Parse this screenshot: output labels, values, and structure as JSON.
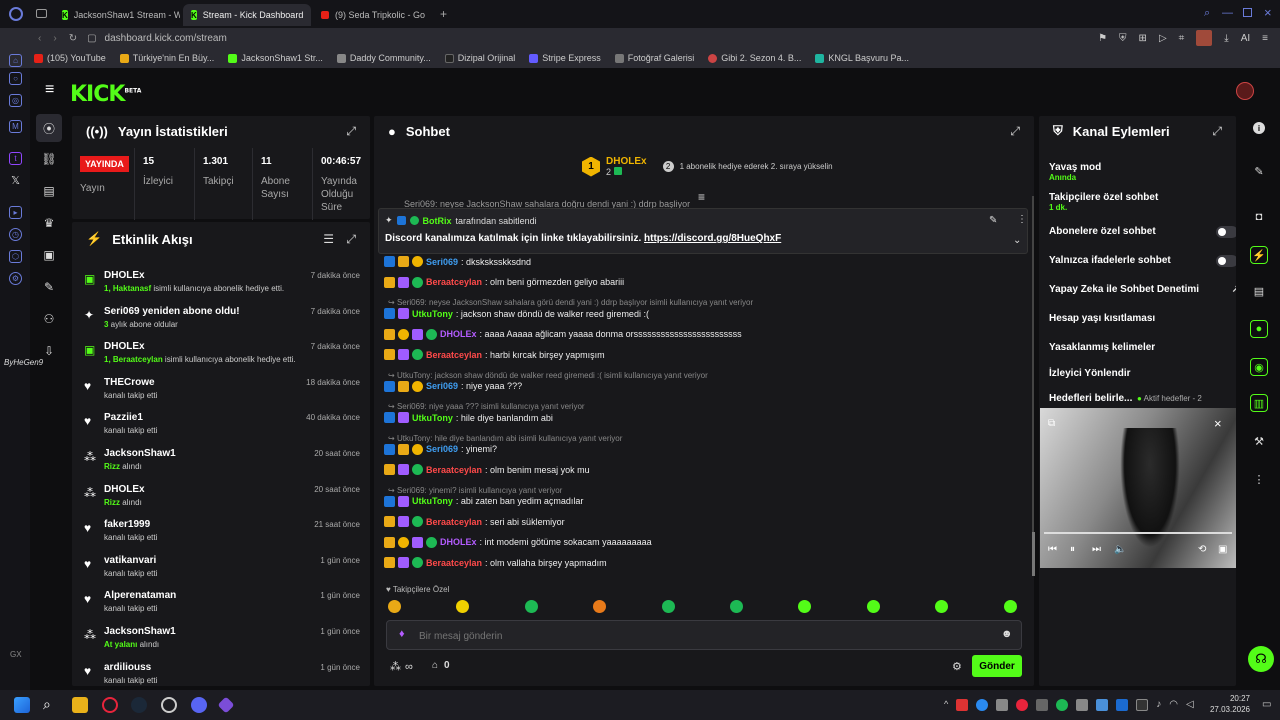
{
  "browser": {
    "tabs": [
      {
        "label": "JacksonShaw1 Stream - W"
      },
      {
        "label": "Stream - Kick Dashboard"
      },
      {
        "label": "(9) Seda Tripkolic - Go"
      }
    ],
    "url": "dashboard.kick.com/stream",
    "bookmarks": [
      "(105) YouTube",
      "Türkiye'nin En Büy...",
      "JacksonShaw1 Str...",
      "Daddy Community...",
      "Dizipal Orijinal",
      "Stripe Express",
      "Fotoğraf Galerisi",
      "Gibi 2. Sezon 4. B...",
      "KNGL Başvuru Pa..."
    ],
    "ai_label": "AI"
  },
  "kick": {
    "logo": "KICK",
    "logo_beta": "BETA",
    "watermark": "ByHeGen9"
  },
  "stats": {
    "title": "Yayın İstatistikleri",
    "live_badge": "YAYINDA",
    "live_label": "Yayın",
    "cells": [
      {
        "value": "15",
        "label": "İzleyici"
      },
      {
        "value": "1.301",
        "label": "Takipçi"
      },
      {
        "value": "11",
        "label": "Abone Sayısı"
      },
      {
        "value": "00:46:57",
        "label": "Yayında Olduğu Süre"
      }
    ]
  },
  "activity": {
    "title": "Etkinlik Akışı",
    "items": [
      {
        "name": "DHOLEx",
        "sub_hl": "1, Haktanasf",
        "sub": " isimli kullanıcıya abonelik hediye etti.",
        "time": "7 dakika önce",
        "icon": "gift"
      },
      {
        "name": "Seri069 yeniden abone oldu!",
        "sub_hl": "3",
        "sub": " aylık abone oldular",
        "time": "7 dakika önce",
        "icon": "star"
      },
      {
        "name": "DHOLEx",
        "sub_hl": "1, Beraatceylan",
        "sub": " isimli kullanıcıya abonelik hediye etti.",
        "time": "7 dakika önce",
        "icon": "gift"
      },
      {
        "name": "THECrowe",
        "sub_hl": "",
        "sub": "kanalı takip etti",
        "time": "18 dakika önce",
        "icon": "heart"
      },
      {
        "name": "Pazziie1",
        "sub_hl": "",
        "sub": "kanalı takip etti",
        "time": "40 dakika önce",
        "icon": "heart"
      },
      {
        "name": "JacksonShaw1",
        "sub_hl": "Rizz",
        "sub": " alındı",
        "time": "20 saat önce",
        "icon": "reward"
      },
      {
        "name": "DHOLEx",
        "sub_hl": "Rizz",
        "sub": " alındı",
        "time": "20 saat önce",
        "icon": "reward"
      },
      {
        "name": "faker1999",
        "sub_hl": "",
        "sub": "kanalı takip etti",
        "time": "21 saat önce",
        "icon": "heart"
      },
      {
        "name": "vatikanvari",
        "sub_hl": "",
        "sub": "kanalı takip etti",
        "time": "1 gün önce",
        "icon": "heart"
      },
      {
        "name": "Alperenataman",
        "sub_hl": "",
        "sub": "kanalı takip etti",
        "time": "1 gün önce",
        "icon": "heart"
      },
      {
        "name": "JacksonShaw1",
        "sub_hl": "At yalanı",
        "sub": " alındı",
        "time": "1 gün önce",
        "icon": "reward"
      },
      {
        "name": "ardiliouss",
        "sub_hl": "",
        "sub": "kanalı takip etti",
        "time": "1 gün önce",
        "icon": "heart"
      }
    ]
  },
  "chat": {
    "title": "Sohbet",
    "top_gifter": {
      "name": "DHOLEx",
      "rank": "1",
      "count": "2",
      "note": "1 abonelik hediye ederek 2. sıraya yükselin",
      "note_num": "2"
    },
    "scrolled": "Seri069: neyse JacksonShaw sahalara doğru dendi yani :) ddrp başliyor",
    "pinned": {
      "by": "BotRix",
      "by_suffix": " tarafından sabitlendi",
      "text": "Discord kanalımıza katılmak için linke tıklayabilirsiniz. ",
      "link": "https://discord.gg/8HueQhxF"
    },
    "messages": [
      {
        "type": "msg",
        "user": "Seri069",
        "cls": "u1",
        "badges": [
          "b1",
          "b2",
          "b3"
        ],
        "text": ": dksksksskksdnd"
      },
      {
        "type": "msg",
        "user": "Beraatceylan",
        "cls": "u2",
        "badges": [
          "b2",
          "b5",
          "b4"
        ],
        "text": ": olm beni görmezden geliyo abariii"
      },
      {
        "type": "reply",
        "text": "Seri069: neyse JacksonShaw sahalara görü dendi yani :) ddrp başlıyor isimli kullanıcıya yanıt veriyor"
      },
      {
        "type": "msg",
        "user": "UtkuTony",
        "cls": "u3",
        "badges": [
          "b1",
          "b5"
        ],
        "text": ": jackson shaw döndü de walker reed giremedi :("
      },
      {
        "type": "msg",
        "user": "DHOLEx",
        "cls": "u4",
        "badges": [
          "b2",
          "b3",
          "b5",
          "b4"
        ],
        "text": ": aaaa Aaaaa ağlicam yaaaa donma orssssssssssssssssssssssss"
      },
      {
        "type": "msg",
        "user": "Beraatceylan",
        "cls": "u2",
        "badges": [
          "b2",
          "b5",
          "b4"
        ],
        "text": ": harbi kırcak birşey yapmışım"
      },
      {
        "type": "reply",
        "text": "UtkuTony: jackson shaw döndü de walker reed giremedi :( isimli kullanıcıya yanıt veriyor"
      },
      {
        "type": "msg",
        "user": "Seri069",
        "cls": "u1",
        "badges": [
          "b1",
          "b2",
          "b3"
        ],
        "text": ": niye yaaa ???"
      },
      {
        "type": "reply",
        "text": "Seri069: niye yaaa ??? isimli kullanıcıya yanıt veriyor"
      },
      {
        "type": "msg",
        "user": "UtkuTony",
        "cls": "u3",
        "badges": [
          "b1",
          "b5"
        ],
        "text": ": hile diye banlandım abi"
      },
      {
        "type": "reply",
        "text": "UtkuTony: hile diye banlandım abi isimli kullanıcıya yanıt veriyor"
      },
      {
        "type": "msg",
        "user": "Seri069",
        "cls": "u1",
        "badges": [
          "b1",
          "b2",
          "b3"
        ],
        "text": ": yinemi?"
      },
      {
        "type": "msg",
        "user": "Beraatceylan",
        "cls": "u2",
        "badges": [
          "b2",
          "b5",
          "b4"
        ],
        "text": ": olm benim mesaj yok mu"
      },
      {
        "type": "reply",
        "text": "Seri069: yinemi? isimli kullanıcıya yanıt veriyor"
      },
      {
        "type": "msg",
        "user": "UtkuTony",
        "cls": "u3",
        "badges": [
          "b1",
          "b5"
        ],
        "text": ": abi zaten ban yedim açmadılar"
      },
      {
        "type": "msg",
        "user": "Beraatceylan",
        "cls": "u2",
        "badges": [
          "b2",
          "b5",
          "b4"
        ],
        "text": ": seri abi süklemiyor"
      },
      {
        "type": "msg",
        "user": "DHOLEx",
        "cls": "u4",
        "badges": [
          "b2",
          "b3",
          "b5",
          "b4"
        ],
        "text": ": int modemi götüme sokacam yaaaaaaaaa"
      },
      {
        "type": "msg",
        "user": "Beraatceylan",
        "cls": "u2",
        "badges": [
          "b2",
          "b5",
          "b4"
        ],
        "text": ": olm vallaha birşey yapmadım"
      }
    ],
    "emote_label": "Takipçilere Özel",
    "input_placeholder": "Bir mesaj gönderin",
    "points": "∞",
    "bag_count": "0",
    "send_label": "Gönder"
  },
  "channel": {
    "title": "Kanal Eylemleri",
    "items": [
      {
        "label": "Yavaş mod",
        "sub": "Anında",
        "ctrl": "chev"
      },
      {
        "label": "Takipçilere özel sohbet",
        "sub": "1 dk.",
        "ctrl": "chev"
      },
      {
        "label": "Abonelere özel sohbet",
        "sub": "",
        "ctrl": "toggle"
      },
      {
        "label": "Yalnızca ifadelerle sohbet",
        "sub": "",
        "ctrl": "toggle"
      },
      {
        "label": "Yapay Zeka ile Sohbet Denetimi",
        "sub": "",
        "ctrl": "ext"
      },
      {
        "label": "Hesap yaşı kısıtlaması",
        "sub": "",
        "ctrl": "chev"
      },
      {
        "label": "Yasaklanmış kelimeler",
        "sub": "",
        "ctrl": "chev"
      },
      {
        "label": "İzleyici Yönlendir",
        "sub": "",
        "ctrl": "none"
      },
      {
        "label": "Hedefleri belirle...",
        "sub": "",
        "ctrl": "chev",
        "extra": "Aktif hedefler - 2"
      }
    ]
  },
  "taskbar": {
    "time": "20:27",
    "date": "27.03.2026"
  },
  "colors": {
    "accent": "#53fc18",
    "bg": "#0e0e10",
    "panel": "#18181b",
    "live": "#e81a1a"
  }
}
